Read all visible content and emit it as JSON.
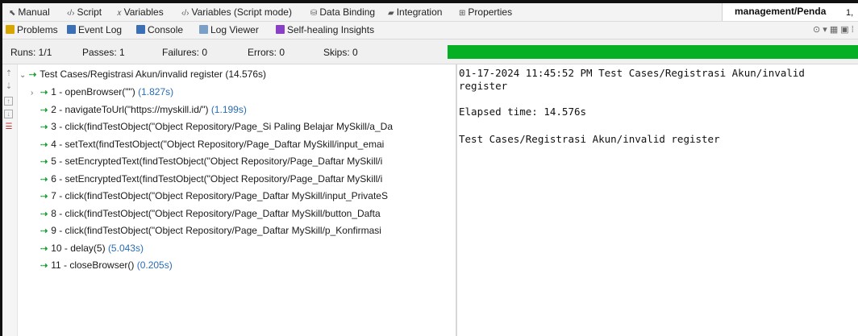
{
  "editor_tabs": [
    {
      "icon": "manual-icon",
      "glyph": "⬉",
      "label": "Manual"
    },
    {
      "icon": "script-icon",
      "glyph": "‹/›",
      "label": "Script"
    },
    {
      "icon": "variables-icon",
      "glyph": "𝑥",
      "label": "Variables"
    },
    {
      "icon": "script-mode-icon",
      "glyph": "‹/›",
      "label": "Variables (Script mode)"
    },
    {
      "icon": "database-icon",
      "glyph": "⛁",
      "label": "Data Binding"
    },
    {
      "icon": "integration-icon",
      "glyph": "▰",
      "label": "Integration"
    },
    {
      "icon": "properties-icon",
      "glyph": "⊞",
      "label": "Properties"
    }
  ],
  "side_panel": {
    "title": "management/Penda",
    "tail": "1,"
  },
  "view_tabs": [
    {
      "icon": "problems-icon",
      "label": "Problems",
      "color": "#d9a500"
    },
    {
      "icon": "event-log-icon",
      "label": "Event Log",
      "color": "#3b6fb6"
    },
    {
      "icon": "console-icon",
      "label": "Console",
      "color": "#3b6fb6"
    },
    {
      "icon": "log-viewer-icon",
      "label": "Log Viewer",
      "color": "#7aa0c8"
    },
    {
      "icon": "self-healing-icon",
      "label": "Self-healing Insights",
      "color": "#8b3fc9"
    }
  ],
  "view_tools": "⊙ ▾ ▦ ▣ ⁞",
  "status": {
    "runs": "Runs: 1/1",
    "passes": "Passes: 1",
    "failures": "Failures: 0",
    "errors": "Errors: 0",
    "skips": "Skips: 0",
    "progress_fraction": 1.0,
    "progress_color": "#06b025"
  },
  "tree": {
    "root": {
      "label": "Test Cases/Registrasi Akun/invalid register",
      "duration": "(14.576s)"
    },
    "steps": [
      {
        "label": "1 - openBrowser(\"\")",
        "duration": "(1.827s)",
        "expandable": true
      },
      {
        "label": "2 - navigateToUrl(\"https://myskill.id/\")",
        "duration": "(1.199s)",
        "expandable": false
      },
      {
        "label": "3 - click(findTestObject(\"Object Repository/Page_Si Paling Belajar  MySkill/a_Da",
        "duration": "",
        "expandable": false
      },
      {
        "label": "4 - setText(findTestObject(\"Object Repository/Page_Daftar  MySkill/input_emai",
        "duration": "",
        "expandable": false
      },
      {
        "label": "5 - setEncryptedText(findTestObject(\"Object Repository/Page_Daftar  MySkill/i",
        "duration": "",
        "expandable": false
      },
      {
        "label": "6 - setEncryptedText(findTestObject(\"Object Repository/Page_Daftar  MySkill/i",
        "duration": "",
        "expandable": false
      },
      {
        "label": "7 - click(findTestObject(\"Object Repository/Page_Daftar  MySkill/input_PrivateS",
        "duration": "",
        "expandable": false
      },
      {
        "label": "8 - click(findTestObject(\"Object Repository/Page_Daftar  MySkill/button_Dafta",
        "duration": "",
        "expandable": false
      },
      {
        "label": "9 - click(findTestObject(\"Object Repository/Page_Daftar  MySkill/p_Konfirmasi",
        "duration": "",
        "expandable": false
      },
      {
        "label": "10 - delay(5)",
        "duration": "(5.043s)",
        "expandable": false
      },
      {
        "label": "11 - closeBrowser()",
        "duration": "(0.205s)",
        "expandable": false
      }
    ]
  },
  "log": {
    "line1": "01-17-2024 11:45:52 PM Test Cases/Registrasi Akun/invalid",
    "line2": "register",
    "elapsed": "Elapsed time: 14.576s",
    "result": "Test Cases/Registrasi Akun/invalid register"
  }
}
